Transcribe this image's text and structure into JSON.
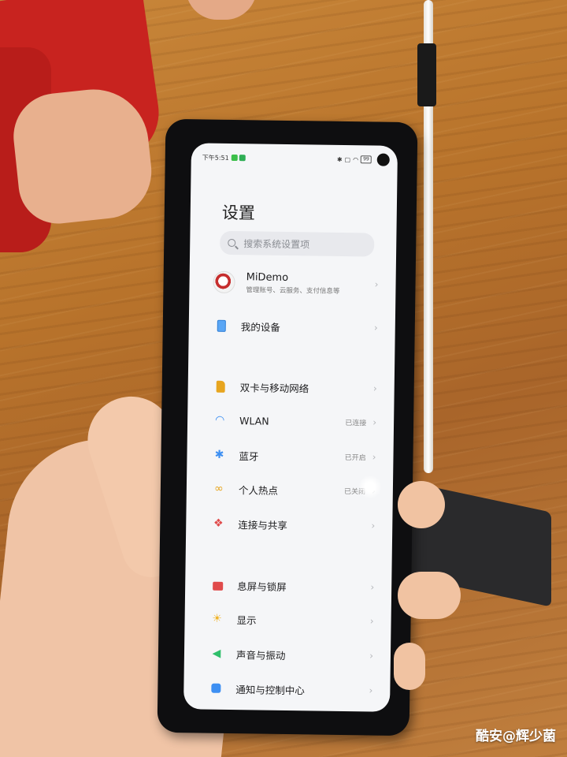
{
  "status_bar": {
    "time": "下午5:51",
    "battery": "99"
  },
  "settings": {
    "title": "设置",
    "search_placeholder": "搜索系统设置项",
    "account": {
      "name": "MiDemo",
      "subtitle": "管理账号、云服务、支付信息等"
    },
    "items": [
      {
        "label": "我的设备",
        "status": "",
        "icon": "device-icon",
        "color": "#3d8ff2"
      },
      {
        "label": "双卡与移动网络",
        "status": "",
        "icon": "sim-icon",
        "color": "#e7a51f"
      },
      {
        "label": "WLAN",
        "status": "已连接",
        "icon": "wifi-icon",
        "color": "#3d8ff2"
      },
      {
        "label": "蓝牙",
        "status": "已开启",
        "icon": "bluetooth-icon",
        "color": "#3d8ff2"
      },
      {
        "label": "个人热点",
        "status": "已关闭",
        "icon": "hotspot-icon",
        "color": "#e7a51f"
      },
      {
        "label": "连接与共享",
        "status": "",
        "icon": "share-icon",
        "color": "#e04b4b"
      },
      {
        "label": "息屏与锁屏",
        "status": "",
        "icon": "lock-icon",
        "color": "#e04b4b"
      },
      {
        "label": "显示",
        "status": "",
        "icon": "brightness-icon",
        "color": "#f0b429"
      },
      {
        "label": "声音与振动",
        "status": "",
        "icon": "sound-icon",
        "color": "#2fbf6b"
      },
      {
        "label": "通知与控制中心",
        "status": "",
        "icon": "notification-icon",
        "color": "#3d8ff2"
      }
    ]
  },
  "watermark": "酷安@辉少菌"
}
